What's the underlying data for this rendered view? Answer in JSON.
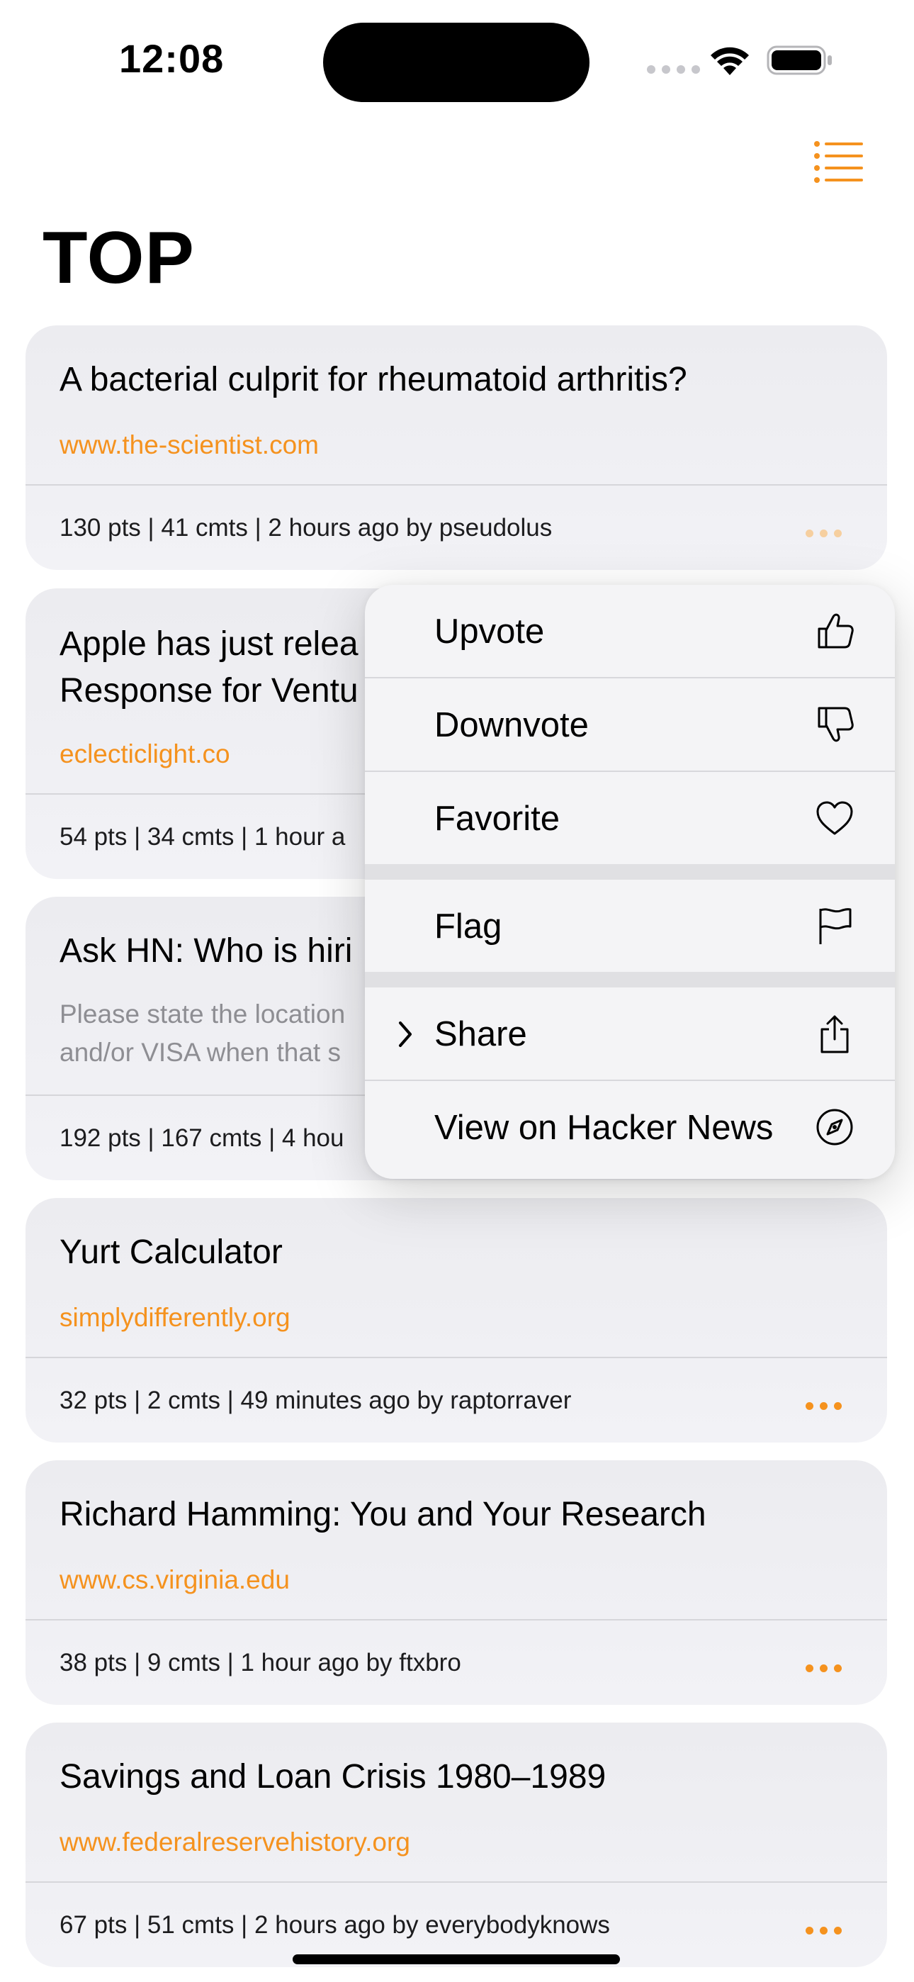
{
  "status": {
    "time": "12:08"
  },
  "page": {
    "title": "TOP"
  },
  "colors": {
    "accent": "#f5921e"
  },
  "stories": [
    {
      "title": "A bacterial culprit for rheumatoid arthritis?",
      "domain": "www.the-scientist.com",
      "meta": "130 pts | 41 cmts | 2 hours ago by pseudolus"
    },
    {
      "title_line1": "Apple has just relea",
      "title_line2": "Response for Ventu",
      "domain": "eclecticlight.co",
      "meta": "54 pts | 34 cmts | 1 hour a"
    },
    {
      "title": "Ask HN: Who is hiri",
      "text_line1": "Please state the location",
      "text_line2": "and/or VISA when that s",
      "meta": "192 pts | 167 cmts | 4 hou"
    },
    {
      "title": "Yurt Calculator",
      "domain": "simplydifferently.org",
      "meta": "32 pts | 2 cmts | 49 minutes ago by raptorraver"
    },
    {
      "title": "Richard Hamming: You and Your Research",
      "domain": "www.cs.virginia.edu",
      "meta": "38 pts | 9 cmts | 1 hour ago by ftxbro"
    },
    {
      "title": "Savings and Loan Crisis 1980–1989",
      "domain": "www.federalreservehistory.org",
      "meta": "67 pts | 51 cmts | 2 hours ago by everybodyknows"
    }
  ],
  "context_menu": {
    "upvote": "Upvote",
    "downvote": "Downvote",
    "favorite": "Favorite",
    "flag": "Flag",
    "share": "Share",
    "view": "View on Hacker News",
    "icons": [
      "thumbs-up-icon",
      "thumbs-down-icon",
      "heart-icon",
      "flag-icon",
      "share-icon",
      "compass-icon"
    ]
  }
}
